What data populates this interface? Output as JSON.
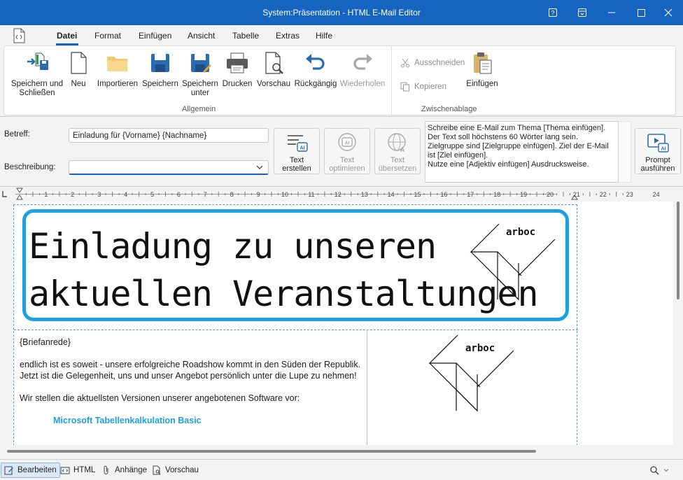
{
  "window": {
    "title": "System:Präsentation - HTML E-Mail Editor"
  },
  "menu": {
    "tabs": [
      {
        "label": "Datei",
        "active": true
      },
      {
        "label": "Format"
      },
      {
        "label": "Einfügen"
      },
      {
        "label": "Ansicht"
      },
      {
        "label": "Tabelle"
      },
      {
        "label": "Extras"
      },
      {
        "label": "Hilfe"
      }
    ]
  },
  "ribbon": {
    "general": {
      "label": "Allgemein",
      "buttons": [
        {
          "label": "Speichern und\nSchließen",
          "icon": "save-close-icon"
        },
        {
          "label": "Neu",
          "icon": "new-document-icon"
        },
        {
          "label": "Importieren",
          "icon": "folder-icon"
        },
        {
          "label": "Speichern",
          "icon": "save-icon"
        },
        {
          "label": "Speichern\nunter",
          "icon": "save-as-icon"
        },
        {
          "label": "Drucken",
          "icon": "printer-icon"
        },
        {
          "label": "Vorschau",
          "icon": "preview-icon"
        },
        {
          "label": "Rückgängig",
          "icon": "undo-icon"
        },
        {
          "label": "Wiederholen",
          "icon": "redo-icon",
          "disabled": true
        }
      ]
    },
    "clipboard": {
      "label": "Zwischenablage",
      "cut": "Ausschneiden",
      "copy": "Kopieren",
      "paste": "Einfügen"
    }
  },
  "form": {
    "subject_label": "Betreff:",
    "subject_value": "Einladung für {Vorname} {Nachname}",
    "description_label": "Beschreibung:",
    "description_value": "",
    "ai_buttons": [
      {
        "label": "Text\nerstellen",
        "disabled": false
      },
      {
        "label": "Text\noptimieren",
        "disabled": true
      },
      {
        "label": "Text\nübersetzen",
        "disabled": true
      }
    ],
    "prompt_text": "Schreibe eine E-Mail zum Thema [Thema einfügen].\nDer Text soll höchstens 60 Wörter lang sein.\nZielgruppe sind [Zielgruppe einfügen]. Ziel der E-Mail ist [Ziel einfügen].\nNutze eine [Adjektiv einfügen] Ausdrucksweise.",
    "run_prompt_label": "Prompt\nausführen"
  },
  "ruler": {
    "numbers": [
      "1",
      "2",
      "3",
      "4",
      "5",
      "6",
      "7",
      "8",
      "9",
      "10",
      "11",
      "12",
      "13",
      "14",
      "15",
      "16",
      "17",
      "18",
      "19",
      "20",
      "21",
      "22",
      "23",
      "24"
    ]
  },
  "document": {
    "headline_line1": "Einladung zu unseren",
    "headline_line2": "aktuellen Veranstaltungen",
    "logo_text": "arboc",
    "salutation": "{Briefanrede}",
    "paragraph1": "endlich ist es soweit - unsere erfolgreiche Roadshow kommt in den Süden der Republik. Jetzt ist die Gelegenheit, uns und unser Angebot persönlich unter die Lupe zu nehmen!",
    "paragraph2": "Wir stellen die aktuellsten Versionen unserer angebotenen Software vor:",
    "list_item1": "Microsoft Tabellenkalkulation Basic"
  },
  "statusbar": {
    "edit": "Bearbeiten",
    "html": "HTML",
    "attachments": "Anhänge",
    "preview": "Vorschau"
  },
  "colors": {
    "titlebar": "#1565c0",
    "accent": "#1ba1e2"
  }
}
